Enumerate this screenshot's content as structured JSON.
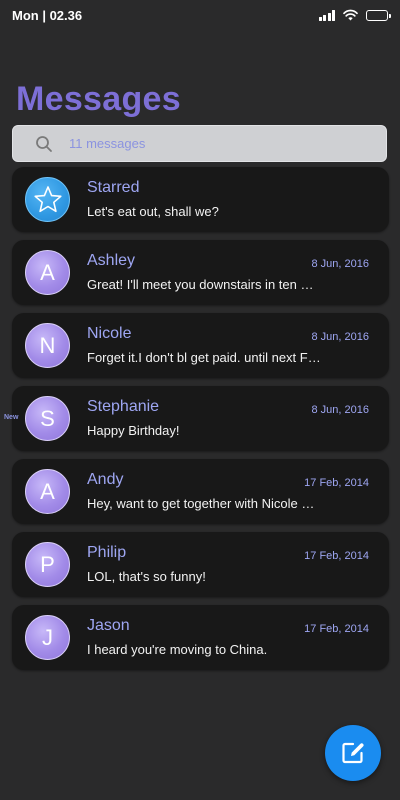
{
  "status_bar": {
    "time": "Mon | 02.36"
  },
  "header": {
    "title": "Messages"
  },
  "search": {
    "placeholder": "11 messages"
  },
  "conversations": [
    {
      "avatar_letter": "",
      "avatar_icon": "star-icon",
      "name": "Starred",
      "date": "",
      "preview": "Let's eat out, shall we?"
    },
    {
      "avatar_letter": "A",
      "name": "Ashley",
      "date": "8 Jun, 2016",
      "preview": "Great! I'll meet you downstairs in ten …"
    },
    {
      "avatar_letter": "N",
      "name": "Nicole",
      "date": "8 Jun, 2016",
      "preview": "Forget it.I don't bl get paid. until next F…"
    },
    {
      "avatar_letter": "S",
      "name": "Stephanie",
      "date": "8 Jun, 2016",
      "preview": "Happy Birthday!",
      "badge": "New"
    },
    {
      "avatar_letter": "A",
      "name": "Andy",
      "date": "17 Feb, 2014",
      "preview": "Hey, want to get together with Nicole …"
    },
    {
      "avatar_letter": "P",
      "name": "Philip",
      "date": "17 Feb, 2014",
      "preview": "LOL, that's so funny!"
    },
    {
      "avatar_letter": "J",
      "name": "Jason",
      "date": "17 Feb, 2014",
      "preview": "I heard you're moving to China."
    }
  ],
  "fab": {
    "icon": "compose-icon"
  },
  "colors": {
    "background": "#2a2a2b",
    "card": "#181818",
    "title": "#7d6fd6",
    "accent_text": "#9ea6f2",
    "avatar": "#a28be8",
    "starred_avatar": "#2f98e2",
    "fab": "#1a8cf0"
  }
}
